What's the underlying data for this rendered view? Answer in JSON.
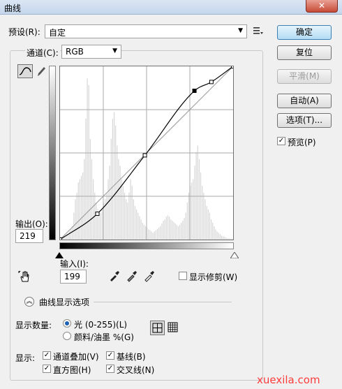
{
  "window": {
    "title": "曲线",
    "close_glyph": "✕"
  },
  "preset": {
    "label": "预设(R):",
    "value": "自定",
    "menu_icon": "list-menu-icon"
  },
  "channel": {
    "label": "通道(C):",
    "value": "RGB"
  },
  "buttons": {
    "ok": "确定",
    "reset": "复位",
    "smooth": "平滑(M)",
    "auto": "自动(A)",
    "options": "选项(T)..."
  },
  "preview": {
    "label": "预览(P)",
    "checked": true
  },
  "output": {
    "label": "输出(O):",
    "value": "219"
  },
  "input": {
    "label": "输入(I):",
    "value": "199"
  },
  "show_clipping": {
    "label": "显示修剪(W)",
    "checked": false
  },
  "curve_display_options": {
    "label": "曲线显示选项",
    "expand_glyph": "︽"
  },
  "show_amount": {
    "label": "显示数量:",
    "light": "光 (0-255)(L)",
    "pigment": "颜料/油墨 %(G)",
    "selected": "light"
  },
  "show": {
    "label": "显示:",
    "channel_overlay": "通道叠加(V)",
    "baseline": "基线(B)",
    "histogram": "直方图(H)",
    "intersection": "交叉线(N)"
  },
  "watermark": "xuexila.com",
  "chart_data": {
    "type": "line",
    "x_range": [
      0,
      255
    ],
    "y_range": [
      0,
      255
    ],
    "grid": "4x4",
    "curve_points": [
      [
        0,
        0
      ],
      [
        55,
        38
      ],
      [
        125,
        124
      ],
      [
        198,
        219
      ],
      [
        223,
        232
      ],
      [
        255,
        255
      ]
    ],
    "selected_point": [
      198,
      219
    ],
    "histogram": [
      4,
      3,
      3,
      4,
      6,
      8,
      12,
      16,
      20,
      40,
      60,
      70,
      85,
      90,
      95,
      100,
      120,
      180,
      240,
      230,
      150,
      120,
      90,
      70,
      55,
      45,
      42,
      40,
      45,
      55,
      60,
      70,
      90,
      110,
      150,
      180,
      190,
      170,
      140,
      120,
      110,
      90,
      80,
      70,
      60,
      55,
      70,
      90,
      80,
      60,
      50,
      45,
      40,
      35,
      30,
      25,
      22,
      20,
      18,
      15,
      14,
      12,
      10,
      12,
      14,
      16,
      18,
      20,
      24,
      28,
      30,
      34,
      36,
      34,
      30,
      28,
      26,
      24,
      22,
      20,
      22,
      25,
      28,
      32,
      40,
      55,
      70,
      80,
      85,
      90,
      110,
      130,
      140,
      120,
      100,
      80,
      70,
      60,
      50,
      45,
      40,
      30,
      25,
      20,
      15,
      12,
      10,
      8,
      6,
      5,
      4,
      3,
      2,
      2,
      1,
      1
    ]
  }
}
